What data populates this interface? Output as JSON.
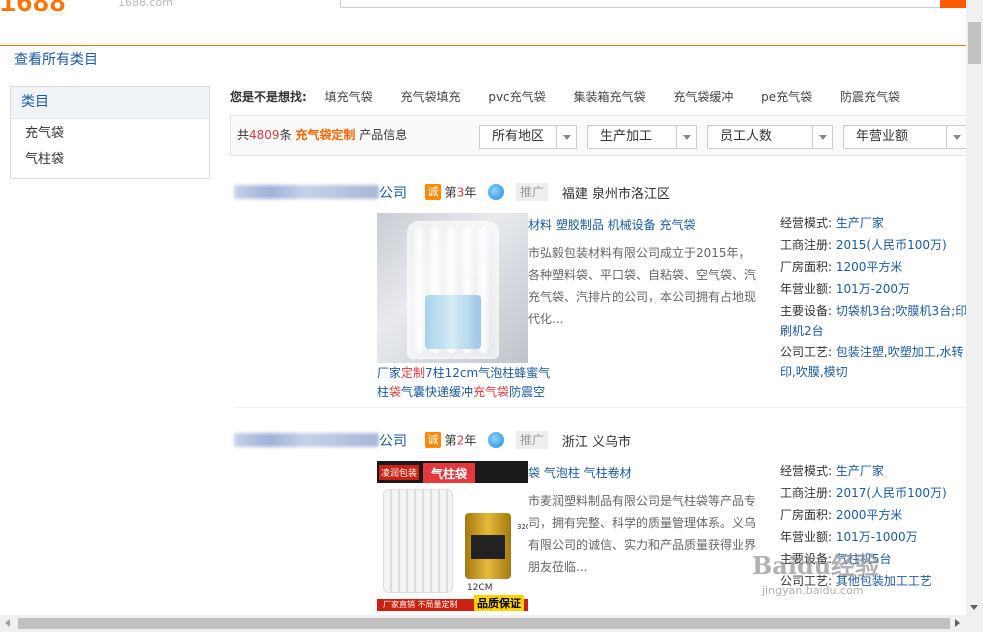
{
  "header": {
    "logo": "1688",
    "logo_sub": "1688.com"
  },
  "all_categories_link": "查看所有类目",
  "sidebar": {
    "title": "类目",
    "items": [
      {
        "label": "充气袋"
      },
      {
        "label": "气柱袋"
      }
    ]
  },
  "suggestions": {
    "label": "您是不是想找:",
    "items": [
      "填充气袋",
      "充气袋填充",
      "pvc充气袋",
      "集装箱充气袋",
      "充气袋缓冲",
      "pe充气袋",
      "防震充气袋"
    ]
  },
  "filterbar": {
    "count_prefix": "共",
    "count": "4809",
    "count_mid": "条",
    "keyword": "充气袋定制",
    "count_suffix": "产品信息",
    "dropdowns": [
      "所有地区",
      "生产加工",
      "员工人数",
      "年营业额"
    ]
  },
  "results": [
    {
      "company_suffix": "公司",
      "cheng_badge": "诚",
      "year_prefix": "第",
      "years": "3",
      "year_suffix": "年",
      "promo": "推广",
      "location": "福建 泉州市洛江区",
      "main_products": "材料 塑胶制品 机械设备 充气袋",
      "description": "市弘毅包装材料有限公司成立于2015年，各种塑料袋、平口袋、自粘袋、空气袋、汽充气袋、汽排片的公司，本公司拥有占地现代化...",
      "caption_parts": [
        "厂家",
        "定制",
        "7柱12cm气泡柱蜂蜜气柱",
        "袋",
        "气囊快递缓冲",
        "充气袋",
        "防震空"
      ],
      "info": [
        {
          "k": "经营模式:",
          "v": "生产厂家"
        },
        {
          "k": "工商注册:",
          "v": "2015(人民币100万)"
        },
        {
          "k": "厂房面积:",
          "v": "1200平方米"
        },
        {
          "k": "年营业额:",
          "v": "101万-200万"
        },
        {
          "k": "主要设备:",
          "v": "切袋机3台;吹膜机3台;印刷机2台"
        },
        {
          "k": "公司工艺:",
          "v": "包装注塑,吹塑加工,水转印,吹膜,模切"
        }
      ]
    },
    {
      "company_suffix": "公司",
      "cheng_badge": "诚",
      "year_prefix": "第",
      "years": "2",
      "year_suffix": "年",
      "promo": "推广",
      "location": "浙江 义乌市",
      "main_products": "袋 气泡柱 气柱卷材",
      "description": "市麦润塑料制品有限公司是气柱袋等产品专司，拥有完整、科学的质量管理体系。义乌有限公司的诚信、实力和产品质量获得业界朋友莅临...",
      "image_texts": {
        "tag_left": "凌润包装",
        "tag_main": "气柱袋",
        "dim_v": "32CM",
        "dim_h": "12CM",
        "bottom_left": "厂家直销 不局量定制",
        "bottom_badge": "品质保证"
      },
      "info": [
        {
          "k": "经营模式:",
          "v": "生产厂家"
        },
        {
          "k": "工商注册:",
          "v": "2017(人民币100万)"
        },
        {
          "k": "厂房面积:",
          "v": "2000平方米"
        },
        {
          "k": "年营业额:",
          "v": "101万-1000万"
        },
        {
          "k": "主要设备:",
          "v": "气柱机5台"
        },
        {
          "k": "公司工艺:",
          "v": "其他包装加工工艺"
        }
      ]
    }
  ],
  "watermark": {
    "big": "Baidu经验",
    "small": "jingyan.baidu.com"
  },
  "colors": {
    "accent": "#ff7300",
    "link": "#1a5aa7",
    "highlight": "#e4393c"
  }
}
